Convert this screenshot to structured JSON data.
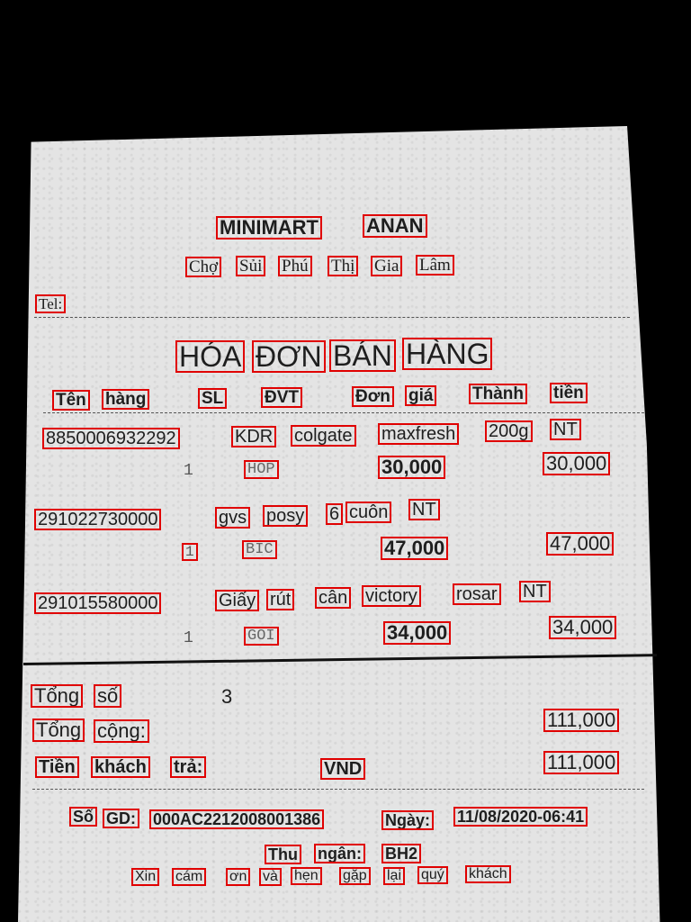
{
  "receipt": {
    "store_name": [
      "MINIMART",
      "ANAN"
    ],
    "address": [
      "Chợ",
      "Sủi",
      "Phú",
      "Thị",
      "Gia",
      "Lâm"
    ],
    "tel_label": "Tel:",
    "title": [
      "HÓA",
      "ĐƠN",
      "BÁN",
      "HÀNG"
    ],
    "columns": {
      "name": [
        "Tên",
        "hàng"
      ],
      "qty": "SL",
      "unit": "ĐVT",
      "price": [
        "Đơn",
        "giá"
      ],
      "amount": [
        "Thành",
        "tiền"
      ]
    },
    "items": [
      {
        "name_words": [
          "8850006932292",
          "KDR",
          "colgate",
          "maxfresh",
          "200g",
          "NT"
        ],
        "qty": "1",
        "unit": "HOP",
        "price": "30,000",
        "amount": "30,000"
      },
      {
        "name_words": [
          "291022730000",
          "gvs",
          "posy",
          "6",
          "cuôn",
          "NT"
        ],
        "qty": "1",
        "unit": "BIC",
        "price": "47,000",
        "amount": "47,000"
      },
      {
        "name_words": [
          "291015580000",
          "Giấy",
          "rút",
          "cân",
          "victory",
          "rosar",
          "NT"
        ],
        "qty": "1",
        "unit": "GOI",
        "price": "34,000",
        "amount": "34,000"
      }
    ],
    "totals": {
      "total_qty_label": [
        "Tổng",
        "số"
      ],
      "total_qty": "3",
      "grand_total_label": [
        "Tổng",
        "cộng:"
      ],
      "grand_total": "111,000",
      "paid_label": [
        "Tiền",
        "khách",
        "trả:"
      ],
      "currency": "VND",
      "paid": "111,000"
    },
    "footer": {
      "txn_label": [
        "Số",
        "GD:"
      ],
      "txn_id": "000AC2212008001386",
      "date_label": "Ngày:",
      "date": "11/08/2020-06:41",
      "cashier_label": [
        "Thu",
        "ngân:"
      ],
      "cashier": "BH2",
      "thanks": [
        "Xin",
        "cám",
        "ơn",
        "và",
        "hẹn",
        "gặp",
        "lại",
        "quý",
        "khách"
      ]
    }
  },
  "colors": {
    "background": "#000000",
    "paper": "#e4e4e4",
    "ink": "#1e1e1e",
    "ocr_box": "#e00000"
  }
}
